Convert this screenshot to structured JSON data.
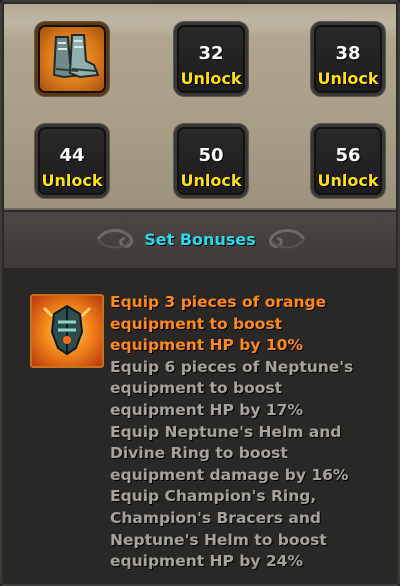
{
  "slots": [
    {
      "type": "item",
      "icon": "neptune-boots-icon"
    },
    {
      "level": "32",
      "status": "Unlock"
    },
    {
      "level": "38",
      "status": "Unlock"
    },
    {
      "level": "44",
      "status": "Unlock"
    },
    {
      "level": "50",
      "status": "Unlock"
    },
    {
      "level": "56",
      "status": "Unlock"
    }
  ],
  "header": {
    "title": "Set Bonuses"
  },
  "bonus": {
    "icon": "neptune-helm-icon",
    "lines": [
      {
        "text": "Equip 3 pieces of orange equipment to boost equipment HP by 10%",
        "active": true
      },
      {
        "text": "Equip 6 pieces of Neptune's equipment to boost equipment HP by 17%",
        "active": false
      },
      {
        "text": "Equip Neptune's Helm and Divine Ring to boost equipment damage by 16%",
        "active": false
      },
      {
        "text": "Equip Champion's Ring, Champion's Bracers and Neptune's Helm to boost equipment HP by 24%",
        "active": false
      }
    ]
  },
  "colors": {
    "active": "#ff8a1a",
    "inactive": "#a6a39f",
    "title": "#2fd8e8",
    "unlock": "#ffe400"
  }
}
